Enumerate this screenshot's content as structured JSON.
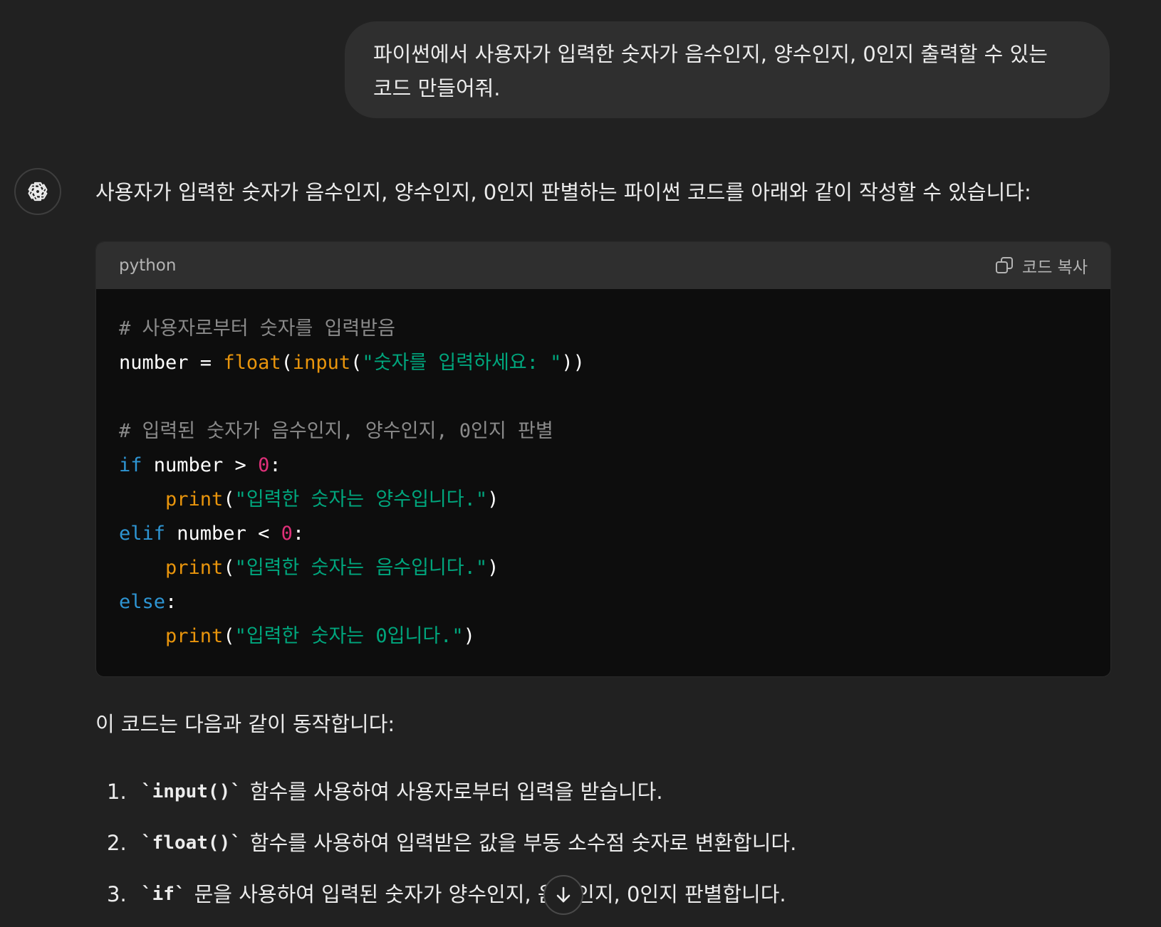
{
  "user_message": {
    "line1": "파이썬에서 사용자가 입력한 숫자가 음수인지, 양수인지, 0인지 출력할 수 있는",
    "line2": "코드 만들어줘."
  },
  "assistant": {
    "avatar_icon": "openai-logo-icon",
    "intro": "사용자가 입력한 숫자가 음수인지, 양수인지, 0인지 판별하는 파이썬 코드를 아래와 같이 작성할 수 있습니다:",
    "code_block": {
      "language": "python",
      "copy_label": "코드 복사",
      "copy_icon": "copy-icon",
      "lines": {
        "l1": "# 사용자로부터 숫자를 입력받음",
        "l2": {
          "var": "number = ",
          "fn1": "float",
          "p1": "(",
          "fn2": "input",
          "p2": "(",
          "str": "\"숫자를 입력하세요: \"",
          "p3": "))"
        },
        "l4": "# 입력된 숫자가 음수인지, 양수인지, 0인지 판별",
        "l5": {
          "kw": "if",
          "rest": " number > ",
          "num": "0",
          "end": ":"
        },
        "l6": {
          "indent": "    ",
          "fn": "print",
          "p1": "(",
          "str": "\"입력한 숫자는 양수입니다.\"",
          "p2": ")"
        },
        "l7": {
          "kw": "elif",
          "rest": " number < ",
          "num": "0",
          "end": ":"
        },
        "l8": {
          "indent": "    ",
          "fn": "print",
          "p1": "(",
          "str": "\"입력한 숫자는 음수입니다.\"",
          "p2": ")"
        },
        "l9": {
          "kw": "else",
          "end": ":"
        },
        "l10": {
          "indent": "    ",
          "fn": "print",
          "p1": "(",
          "str": "\"입력한 숫자는 0입니다.\"",
          "p2": ")"
        }
      }
    },
    "after_code": "이 코드는 다음과 같이 동작합니다:",
    "steps": [
      {
        "num": "1.",
        "code": "`input()`",
        "text": "함수를 사용하여 사용자로부터 입력을 받습니다."
      },
      {
        "num": "2.",
        "code": "`float()`",
        "text": "함수를 사용하여 입력받은 값을 부동 소수점 숫자로 변환합니다."
      },
      {
        "num": "3.",
        "code": "`if`",
        "text": "문을 사용하여 입력된 숫자가 양수인지, 음수인지, 0인지 판별합니다."
      }
    ]
  },
  "scroll_button_icon": "arrow-down-icon",
  "colors": {
    "background": "#212121",
    "user_bubble": "#2f2f2f",
    "code_header": "#2f2f2f",
    "code_background": "#0d0d0d",
    "keyword": "#2e95d3",
    "builtin": "#e9950c",
    "string": "#00a67d",
    "number": "#df3079",
    "comment": "#8a8a8a"
  }
}
